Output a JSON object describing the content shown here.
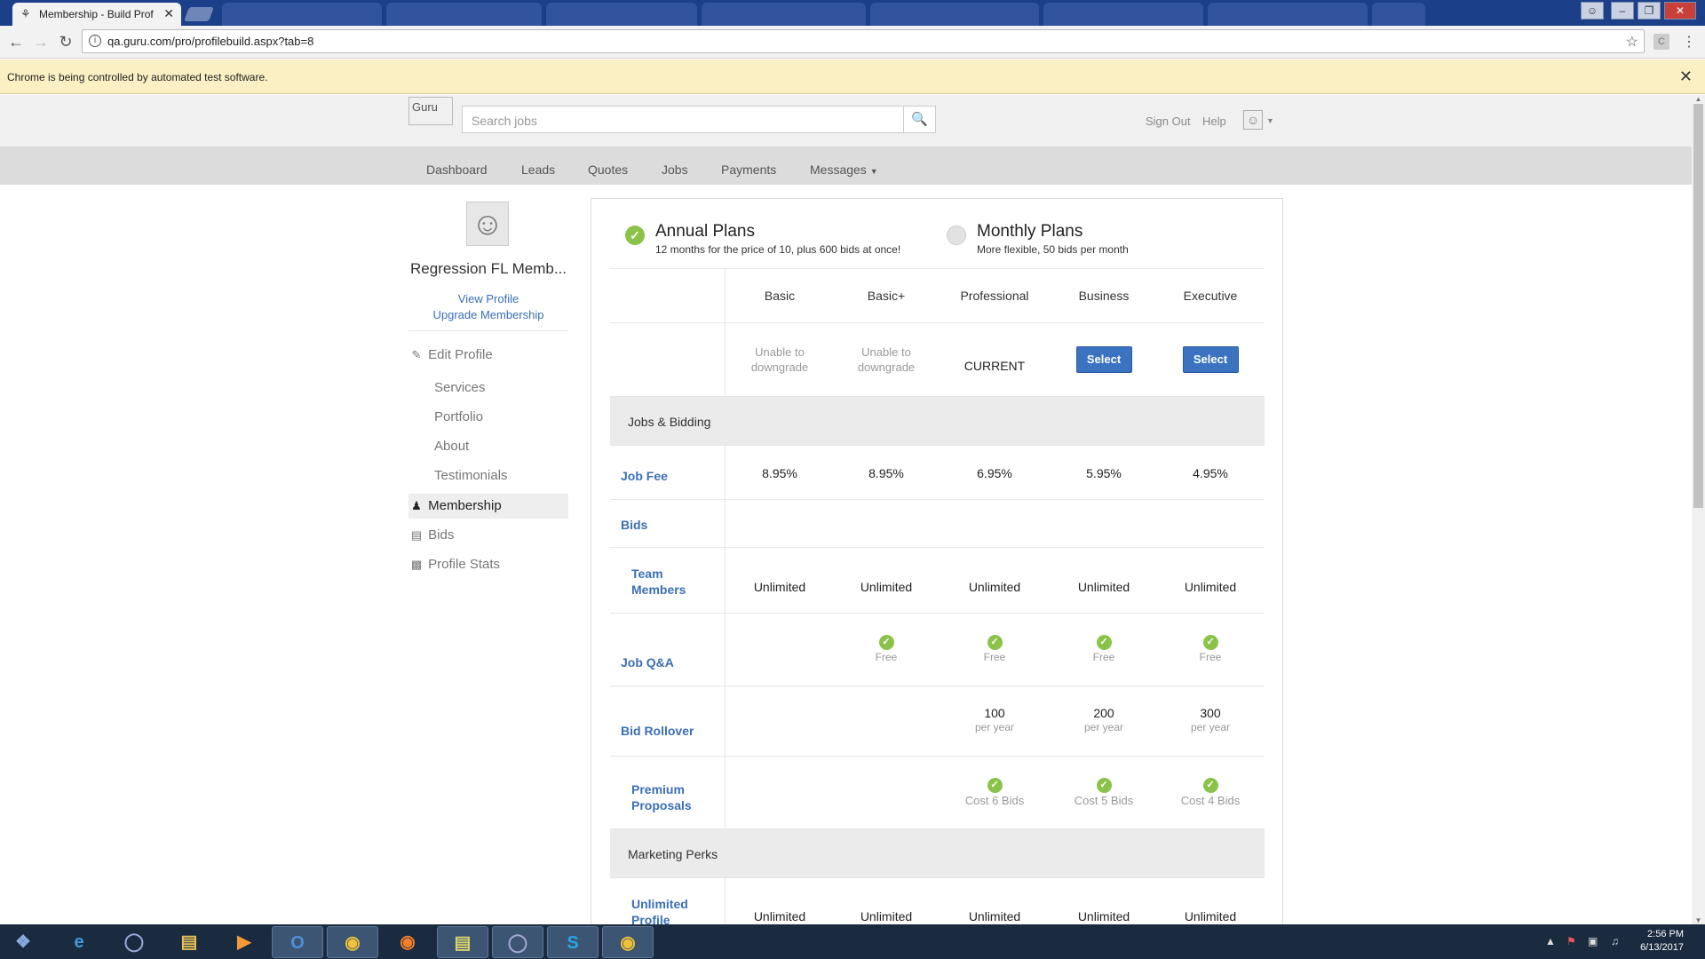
{
  "browser": {
    "active_tab": {
      "title": "Membership - Build Prof",
      "favicon": "guru-icon"
    },
    "url": "qa.guru.com/pro/profilebuild.aspx?tab=8",
    "infobar": "Chrome is being controlled by automated test software."
  },
  "header": {
    "logo_alt": "Guru",
    "search_placeholder": "Search jobs",
    "sign_out": "Sign Out",
    "help": "Help"
  },
  "nav": {
    "items": [
      {
        "label": "Dashboard"
      },
      {
        "label": "Leads"
      },
      {
        "label": "Quotes"
      },
      {
        "label": "Jobs"
      },
      {
        "label": "Payments"
      },
      {
        "label": "Messages"
      }
    ]
  },
  "sidebar": {
    "name": "Regression FL Memb...",
    "view_profile": "View Profile",
    "upgrade": "Upgrade Membership",
    "edit_profile": "Edit Profile",
    "sub_items": [
      {
        "label": "Services"
      },
      {
        "label": "Portfolio"
      },
      {
        "label": "About"
      },
      {
        "label": "Testimonials"
      }
    ],
    "membership": "Membership",
    "bids": "Bids",
    "profile_stats": "Profile Stats"
  },
  "plans": {
    "annual": {
      "title": "Annual Plans",
      "sub": "12 months for the price of 10, plus 600 bids at once!",
      "selected": true
    },
    "monthly": {
      "title": "Monthly Plans",
      "sub": "More flexible, 50 bids per month",
      "selected": false
    }
  },
  "tiers": [
    {
      "name": "Basic",
      "action": "Unable to downgrade",
      "job_fee": "8.95%",
      "team": "Unlimited",
      "qa": "",
      "rollover": "",
      "rollover_unit": "",
      "premium": "",
      "profile": "Unlimited"
    },
    {
      "name": "Basic+",
      "action": "Unable to downgrade",
      "job_fee": "8.95%",
      "team": "Unlimited",
      "qa": "Free",
      "rollover": "",
      "rollover_unit": "",
      "premium": "",
      "profile": "Unlimited"
    },
    {
      "name": "Professional",
      "action": "CURRENT",
      "job_fee": "6.95%",
      "team": "Unlimited",
      "qa": "Free",
      "rollover": "100",
      "rollover_unit": "per year",
      "premium": "Cost 6 Bids",
      "profile": "Unlimited"
    },
    {
      "name": "Business",
      "action": "Select",
      "job_fee": "5.95%",
      "team": "Unlimited",
      "qa": "Free",
      "rollover": "200",
      "rollover_unit": "per year",
      "premium": "Cost 5 Bids",
      "profile": "Unlimited"
    },
    {
      "name": "Executive",
      "action": "Select",
      "job_fee": "4.95%",
      "team": "Unlimited",
      "qa": "Free",
      "rollover": "300",
      "rollover_unit": "per year",
      "premium": "Cost 4 Bids",
      "profile": "Unlimited"
    }
  ],
  "labels": {
    "jobs_bidding": "Jobs & Bidding",
    "job_fee": "Job Fee",
    "bids": "Bids",
    "team_line1": "Team",
    "team_line2": "Members",
    "job_qa": "Job Q&A",
    "bid_rollover": "Bid Rollover",
    "premium_line1": "Premium",
    "premium_line2": "Proposals",
    "marketing_perks": "Marketing Perks",
    "profile_line1": "Unlimited",
    "profile_line2": "Profile"
  },
  "taskbar": {
    "time": "2:56 PM",
    "date": "6/13/2017"
  },
  "colors": {
    "accent": "#3b6fb6",
    "check": "#8bc34a",
    "select_button": "#3b73c0",
    "infobar": "#fbf0c4"
  }
}
